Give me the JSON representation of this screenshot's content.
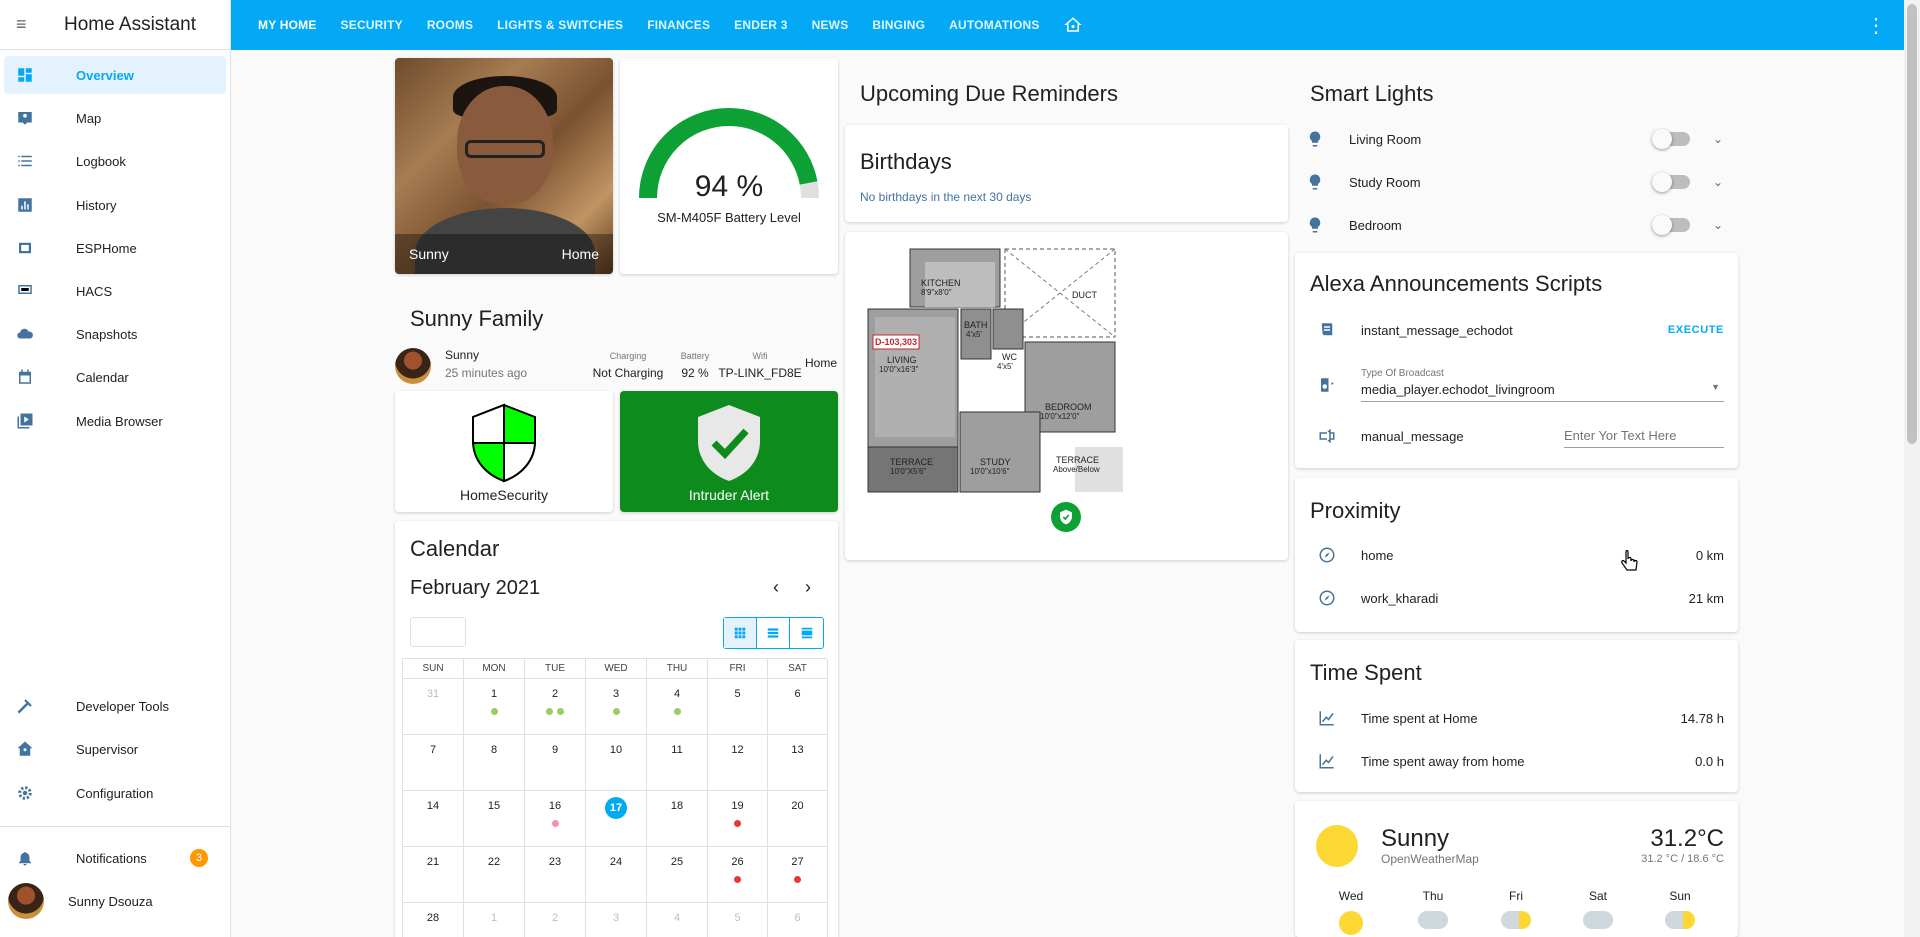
{
  "app": {
    "title": "Home Assistant"
  },
  "sidebar": {
    "items": [
      {
        "label": "Overview",
        "icon": "view-dashboard-icon"
      },
      {
        "label": "Map",
        "icon": "map-account-icon"
      },
      {
        "label": "Logbook",
        "icon": "format-list-bulleted-icon"
      },
      {
        "label": "History",
        "icon": "chart-box-icon"
      },
      {
        "label": "ESPHome",
        "icon": "chip-icon"
      },
      {
        "label": "HACS",
        "icon": "hacs-icon"
      },
      {
        "label": "Snapshots",
        "icon": "cloud-icon"
      },
      {
        "label": "Calendar",
        "icon": "calendar-icon"
      },
      {
        "label": "Media Browser",
        "icon": "play-box-multiple-icon"
      }
    ],
    "bottom": [
      {
        "label": "Developer Tools",
        "icon": "hammer-icon"
      },
      {
        "label": "Supervisor",
        "icon": "home-assistant-icon"
      },
      {
        "label": "Configuration",
        "icon": "cog-icon"
      }
    ],
    "notifications": {
      "label": "Notifications",
      "count": "3"
    },
    "user": {
      "label": "Sunny Dsouza"
    }
  },
  "tabs": [
    "MY HOME",
    "SECURITY",
    "ROOMS",
    "LIGHTS & SWITCHES",
    "FINANCES",
    "ENDER 3",
    "NEWS",
    "BINGING",
    "AUTOMATIONS"
  ],
  "person_card": {
    "name": "Sunny",
    "state": "Home"
  },
  "gauge": {
    "value": "94 %",
    "label": "SM-M405F Battery Level",
    "percent": 94,
    "color": "#0da035"
  },
  "family": {
    "title": "Sunny Family",
    "name": "Sunny",
    "last_seen": "25 minutes ago",
    "charging_label": "Charging",
    "charging_value": "Not Charging",
    "battery_label": "Battery",
    "battery_value": "92 %",
    "wifi_label": "Wifi",
    "wifi_value": "TP-LINK_FD8E",
    "location": "Home"
  },
  "security_buttons": [
    {
      "label": "HomeSecurity"
    },
    {
      "label": "Intruder Alert"
    }
  ],
  "calendar": {
    "title": "Calendar",
    "month": "February 2021",
    "weekdays": [
      "SUN",
      "MON",
      "TUE",
      "WED",
      "THU",
      "FRI",
      "SAT"
    ],
    "weeks": [
      [
        "31",
        "1",
        "2",
        "3",
        "4",
        "5",
        "6"
      ],
      [
        "7",
        "8",
        "9",
        "10",
        "11",
        "12",
        "13"
      ],
      [
        "14",
        "15",
        "16",
        "17",
        "18",
        "19",
        "20"
      ],
      [
        "21",
        "22",
        "23",
        "24",
        "25",
        "26",
        "27"
      ],
      [
        "28",
        "1",
        "2",
        "3",
        "4",
        "5",
        "6"
      ]
    ],
    "today": "17"
  },
  "reminders": {
    "title": "Upcoming Due Reminders"
  },
  "birthdays": {
    "title": "Birthdays",
    "message": "No birthdays in the next 30 days"
  },
  "floorplan": {
    "labels": [
      "KITCHEN",
      "8'9\"x8'0\"",
      "DUCT",
      "D-103,303",
      "LIVING",
      "10'0\"x16'3\"",
      "BATH",
      "4'x5'",
      "WC",
      "4'x5'",
      "BEDROOM",
      "10'0\"x12'0\"",
      "TERRACE",
      "10'0\"X5'6\"",
      "STUDY",
      "10'0\"x10'6\"",
      "TERRACE",
      "Above/Below"
    ]
  },
  "smart_lights": {
    "title": "Smart Lights",
    "items": [
      {
        "label": "Living Room"
      },
      {
        "label": "Study Room"
      },
      {
        "label": "Bedroom"
      }
    ]
  },
  "alexa": {
    "title": "Alexa Announcements Scripts",
    "script": "instant_message_echodot",
    "execute": "EXECUTE",
    "broadcast_label": "Type Of Broadcast",
    "broadcast_value": "media_player.echodot_livingroom",
    "message_name": "manual_message",
    "message_placeholder": "Enter Yor Text Here"
  },
  "proximity": {
    "title": "Proximity",
    "items": [
      {
        "label": "home",
        "value": "0 km"
      },
      {
        "label": "work_kharadi",
        "value": "21 km"
      }
    ]
  },
  "time_spent": {
    "title": "Time Spent",
    "items": [
      {
        "label": "Time spent at Home",
        "value": "14.78 h"
      },
      {
        "label": "Time spent away from home",
        "value": "0.0 h"
      }
    ]
  },
  "weather": {
    "condition": "Sunny",
    "source": "OpenWeatherMap",
    "temp": "31.2°C",
    "range": "31.2 °C / 18.6 °C",
    "forecast": [
      "Wed",
      "Thu",
      "Fri",
      "Sat",
      "Sun"
    ]
  },
  "colors": {
    "accent": "#03a9f4",
    "green": "#0d8c1d",
    "shield_green": "#00ff00",
    "icon": "#44739e"
  }
}
